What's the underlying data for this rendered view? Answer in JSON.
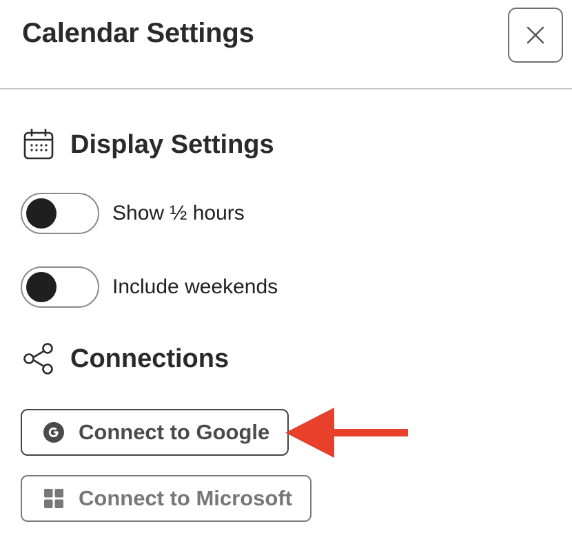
{
  "header": {
    "title": "Calendar Settings",
    "close_icon": "close-icon"
  },
  "display": {
    "heading": "Display Settings",
    "icon": "calendar-icon",
    "toggles": [
      {
        "label": "Show ½ hours",
        "enabled": false
      },
      {
        "label": "Include weekends",
        "enabled": false
      }
    ]
  },
  "connections": {
    "heading": "Connections",
    "icon": "share-icon",
    "buttons": [
      {
        "label": "Connect to Google",
        "icon": "google-icon"
      },
      {
        "label": "Connect to Microsoft",
        "icon": "microsoft-icon"
      }
    ]
  },
  "colors": {
    "annotation_arrow": "#e8402a",
    "text": "#2a2a2a",
    "knob": "#1f1f1f"
  }
}
